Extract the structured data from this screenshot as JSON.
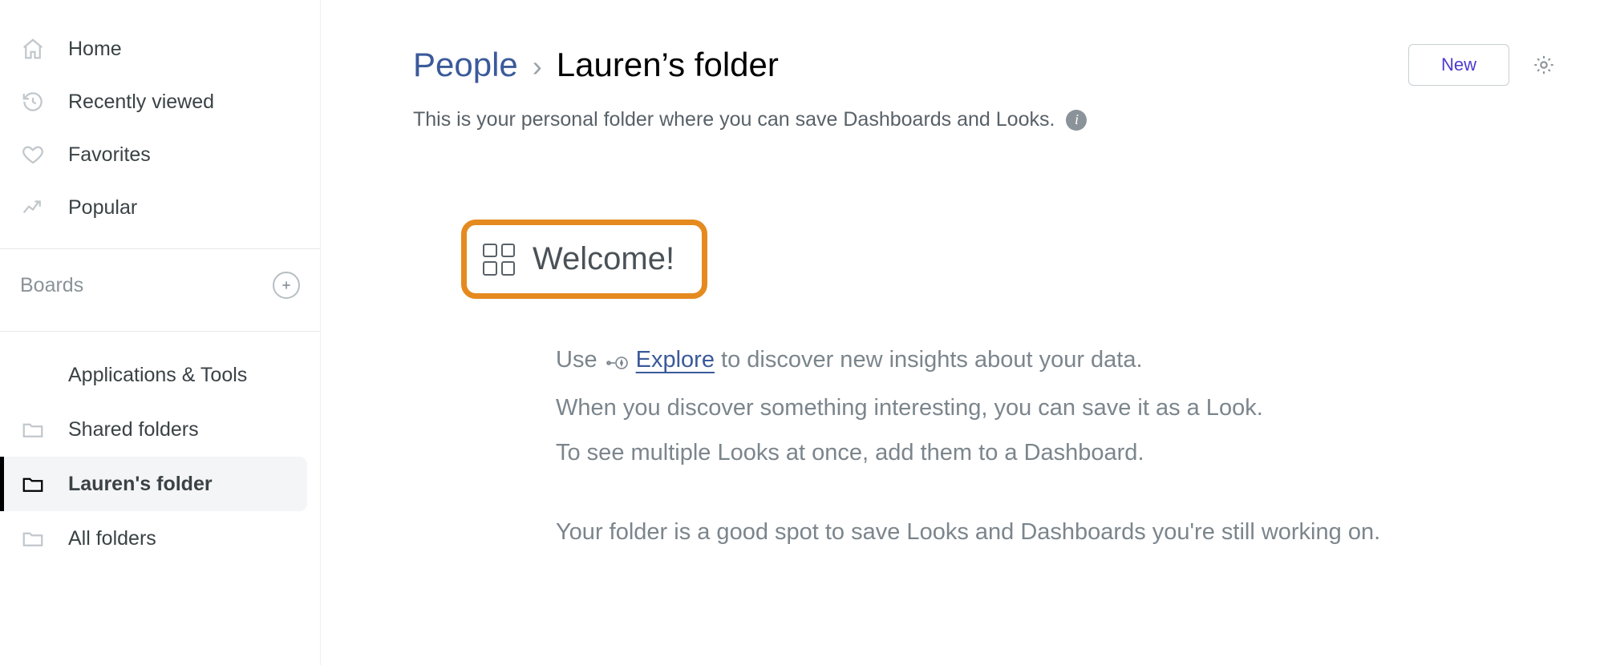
{
  "sidebar": {
    "nav": [
      {
        "label": "Home"
      },
      {
        "label": "Recently viewed"
      },
      {
        "label": "Favorites"
      },
      {
        "label": "Popular"
      }
    ],
    "boards_header": "Boards",
    "folders": [
      {
        "label": "Applications & Tools"
      },
      {
        "label": "Shared folders"
      },
      {
        "label": "Lauren's folder"
      },
      {
        "label": "All folders"
      }
    ]
  },
  "header": {
    "breadcrumb_root": "People",
    "breadcrumb_separator": "›",
    "breadcrumb_current": "Lauren’s folder",
    "new_button": "New",
    "subtitle": "This is your personal folder where you can save Dashboards and Looks.",
    "info_glyph": "i"
  },
  "welcome": {
    "title": "Welcome!",
    "line1_pre": "Use ",
    "line1_link": "Explore",
    "line1_post": " to discover new insights about your data.",
    "line2": "When you discover something interesting, you can save it as a Look.",
    "line3": "To see multiple Looks at once, add them to a Dashboard.",
    "line4": "Your folder is a good spot to save Looks and Dashboards you're still working on."
  }
}
